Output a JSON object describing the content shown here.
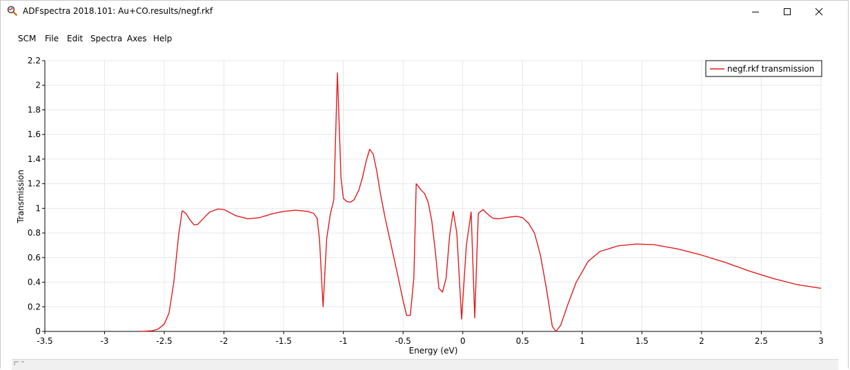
{
  "window": {
    "title": "ADFspectra 2018.101: Au+CO.results/negf.rkf",
    "minimize_icon": "minimize-icon",
    "maximize_icon": "maximize-icon",
    "close_icon": "close-icon",
    "app_icon": "magnifier-spectrum-icon"
  },
  "menu": {
    "items": [
      {
        "label": "SCM"
      },
      {
        "label": "File"
      },
      {
        "label": "Edit"
      },
      {
        "label": "Spectra"
      },
      {
        "label": "Axes"
      },
      {
        "label": "Help"
      }
    ]
  },
  "chart_data": {
    "type": "line",
    "title": "",
    "xlabel": "Energy (eV)",
    "ylabel": "Transmission",
    "xlim": [
      -3.5,
      3
    ],
    "ylim": [
      0,
      2.2
    ],
    "xticks": [
      "-3.5",
      "-3",
      "-2.5",
      "-2",
      "-1.5",
      "-1",
      "-0.5",
      "0",
      "0.5",
      "1",
      "1.5",
      "2",
      "2.5",
      "3"
    ],
    "yticks": [
      "0",
      "0.2",
      "0.4",
      "0.6",
      "0.8",
      "1",
      "1.2",
      "1.4",
      "1.6",
      "1.8",
      "2",
      "2.2"
    ],
    "grid": true,
    "legend_position": "top-right",
    "colors": {
      "series": "#e31a1c",
      "grid": "#e8e8e8"
    },
    "series": [
      {
        "name": "negf.rkf transmission",
        "points": [
          [
            -2.7,
            0.0
          ],
          [
            -2.6,
            0.005
          ],
          [
            -2.55,
            0.02
          ],
          [
            -2.5,
            0.06
          ],
          [
            -2.46,
            0.15
          ],
          [
            -2.42,
            0.4
          ],
          [
            -2.38,
            0.78
          ],
          [
            -2.35,
            0.98
          ],
          [
            -2.32,
            0.96
          ],
          [
            -2.28,
            0.9
          ],
          [
            -2.25,
            0.865
          ],
          [
            -2.22,
            0.87
          ],
          [
            -2.18,
            0.91
          ],
          [
            -2.12,
            0.97
          ],
          [
            -2.05,
            0.995
          ],
          [
            -2.0,
            0.99
          ],
          [
            -1.9,
            0.94
          ],
          [
            -1.8,
            0.915
          ],
          [
            -1.7,
            0.925
          ],
          [
            -1.6,
            0.955
          ],
          [
            -1.5,
            0.975
          ],
          [
            -1.4,
            0.985
          ],
          [
            -1.3,
            0.975
          ],
          [
            -1.25,
            0.96
          ],
          [
            -1.22,
            0.92
          ],
          [
            -1.2,
            0.75
          ],
          [
            -1.17,
            0.2
          ],
          [
            -1.14,
            0.75
          ],
          [
            -1.11,
            0.95
          ],
          [
            -1.08,
            1.07
          ],
          [
            -1.05,
            2.1
          ],
          [
            -1.02,
            1.25
          ],
          [
            -1.0,
            1.08
          ],
          [
            -0.97,
            1.055
          ],
          [
            -0.94,
            1.05
          ],
          [
            -0.91,
            1.07
          ],
          [
            -0.87,
            1.15
          ],
          [
            -0.84,
            1.25
          ],
          [
            -0.81,
            1.38
          ],
          [
            -0.78,
            1.48
          ],
          [
            -0.75,
            1.44
          ],
          [
            -0.72,
            1.3
          ],
          [
            -0.69,
            1.12
          ],
          [
            -0.65,
            0.92
          ],
          [
            -0.6,
            0.7
          ],
          [
            -0.55,
            0.48
          ],
          [
            -0.5,
            0.25
          ],
          [
            -0.47,
            0.13
          ],
          [
            -0.44,
            0.13
          ],
          [
            -0.41,
            0.43
          ],
          [
            -0.39,
            1.2
          ],
          [
            -0.35,
            1.15
          ],
          [
            -0.32,
            1.12
          ],
          [
            -0.29,
            1.05
          ],
          [
            -0.26,
            0.9
          ],
          [
            -0.23,
            0.65
          ],
          [
            -0.2,
            0.35
          ],
          [
            -0.17,
            0.32
          ],
          [
            -0.14,
            0.43
          ],
          [
            -0.11,
            0.78
          ],
          [
            -0.08,
            0.975
          ],
          [
            -0.05,
            0.8
          ],
          [
            -0.01,
            0.1
          ],
          [
            0.03,
            0.7
          ],
          [
            0.07,
            0.97
          ],
          [
            0.1,
            0.11
          ],
          [
            0.13,
            0.96
          ],
          [
            0.17,
            0.99
          ],
          [
            0.2,
            0.96
          ],
          [
            0.25,
            0.92
          ],
          [
            0.3,
            0.915
          ],
          [
            0.4,
            0.93
          ],
          [
            0.45,
            0.935
          ],
          [
            0.5,
            0.925
          ],
          [
            0.55,
            0.88
          ],
          [
            0.6,
            0.8
          ],
          [
            0.65,
            0.62
          ],
          [
            0.7,
            0.35
          ],
          [
            0.75,
            0.04
          ],
          [
            0.78,
            0.0
          ],
          [
            0.82,
            0.05
          ],
          [
            0.88,
            0.22
          ],
          [
            0.95,
            0.4
          ],
          [
            1.05,
            0.57
          ],
          [
            1.15,
            0.65
          ],
          [
            1.3,
            0.695
          ],
          [
            1.45,
            0.71
          ],
          [
            1.6,
            0.705
          ],
          [
            1.8,
            0.67
          ],
          [
            2.0,
            0.62
          ],
          [
            2.2,
            0.56
          ],
          [
            2.4,
            0.49
          ],
          [
            2.6,
            0.43
          ],
          [
            2.8,
            0.38
          ],
          [
            3.0,
            0.35
          ]
        ]
      }
    ]
  }
}
